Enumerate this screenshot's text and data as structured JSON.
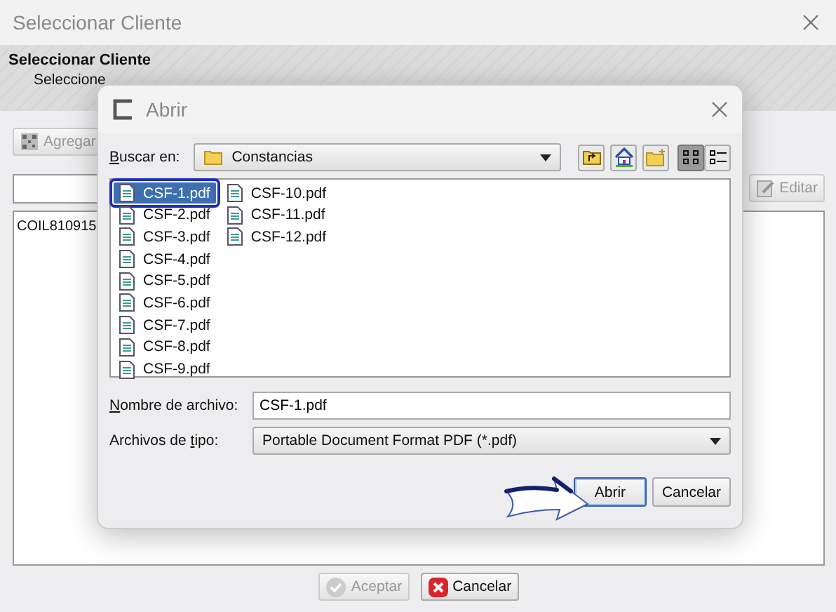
{
  "window": {
    "title": "Seleccionar Cliente"
  },
  "header": {
    "title": "Seleccionar Cliente",
    "subtitle": "Seleccione"
  },
  "toolbar": {
    "add_button": {
      "label": "Agregar",
      "disabled": true
    },
    "edit_button": {
      "label": "Editar",
      "disabled": true
    }
  },
  "client_list": [
    "COIL810915"
  ],
  "buttons": [
    {
      "label": "Aceptar",
      "kind": "accept",
      "disabled": true
    },
    {
      "label": "Cancelar",
      "kind": "cancel",
      "disabled": false
    }
  ],
  "dialog": {
    "title": "Abrir",
    "look_in": {
      "label": {
        "key": "B",
        "rest": "uscar en:"
      },
      "value": "Constancias"
    },
    "views": [
      {
        "kind": "list",
        "selected": true
      },
      {
        "kind": "details",
        "selected": false
      }
    ],
    "files": [
      {
        "name": "CSF-1.pdf",
        "selected": true
      },
      {
        "name": "CSF-2.pdf",
        "selected": false
      },
      {
        "name": "CSF-3.pdf",
        "selected": false
      },
      {
        "name": "CSF-4.pdf",
        "selected": false
      },
      {
        "name": "CSF-5.pdf",
        "selected": false
      },
      {
        "name": "CSF-6.pdf",
        "selected": false
      },
      {
        "name": "CSF-7.pdf",
        "selected": false
      },
      {
        "name": "CSF-8.pdf",
        "selected": false
      },
      {
        "name": "CSF-9.pdf",
        "selected": false
      },
      {
        "name": "CSF-10.pdf",
        "selected": false
      },
      {
        "name": "CSF-11.pdf",
        "selected": false
      },
      {
        "name": "CSF-12.pdf",
        "selected": false
      }
    ],
    "file_name": {
      "label": {
        "key": "N",
        "rest": "ombre de archivo:"
      },
      "value": "CSF-1.pdf"
    },
    "file_type": {
      "label": {
        "text": "Archivos de ",
        "key": "t",
        "rest": "ipo:"
      },
      "value": "Portable Document Format PDF (*.pdf)"
    },
    "buttons": [
      {
        "label": "Abrir",
        "default": true
      },
      {
        "label": "Cancelar",
        "default": false
      }
    ]
  }
}
